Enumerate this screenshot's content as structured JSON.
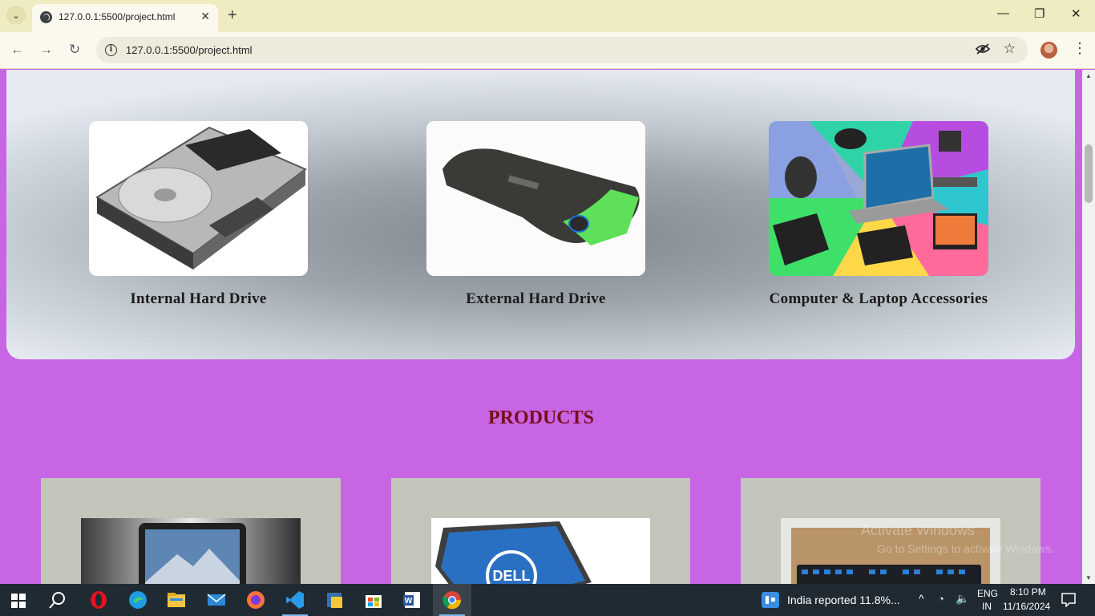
{
  "browser": {
    "tab_title": "127.0.0.1:5500/project.html",
    "url": "127.0.0.1:5500/project.html",
    "new_tab_label": "+",
    "tab_close_label": "✕",
    "menu_label": "⌄"
  },
  "categories": [
    {
      "label": "Internal Hard Drive"
    },
    {
      "label": "External Hard Drive"
    },
    {
      "label": "Computer & Laptop Accessories"
    }
  ],
  "products": {
    "heading": "PRODUCTS"
  },
  "watermark": {
    "line1": "Activate Windows",
    "line2": "Go to Settings to activate Windows."
  },
  "taskbar": {
    "news": "India reported 11.8%...",
    "lang": "ENG",
    "region": "IN",
    "time": "8:10 PM",
    "date": "11/16/2024"
  },
  "colors": {
    "page_bg": "#c765e4",
    "products_heading": "#7a0e1d",
    "product_card_bg": "#c2c5ba"
  }
}
